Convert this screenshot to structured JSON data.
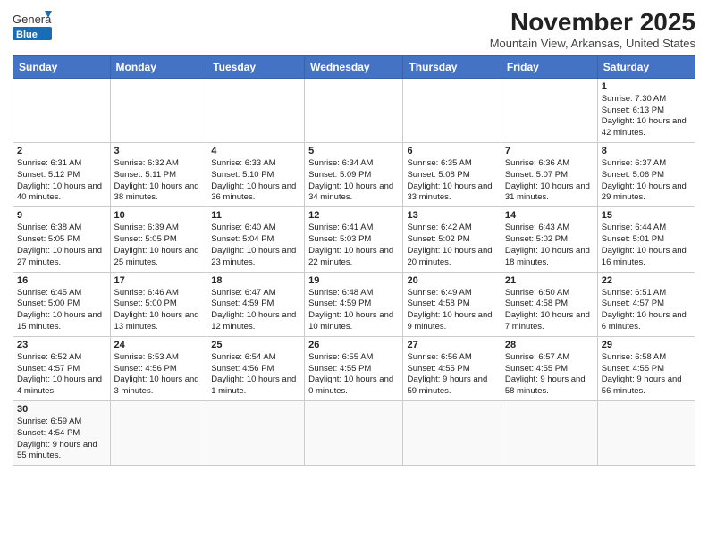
{
  "logo": {
    "text_general": "General",
    "text_blue": "Blue"
  },
  "header": {
    "month": "November 2025",
    "location": "Mountain View, Arkansas, United States"
  },
  "days_of_week": [
    "Sunday",
    "Monday",
    "Tuesday",
    "Wednesday",
    "Thursday",
    "Friday",
    "Saturday"
  ],
  "weeks": [
    [
      {
        "num": "",
        "info": ""
      },
      {
        "num": "",
        "info": ""
      },
      {
        "num": "",
        "info": ""
      },
      {
        "num": "",
        "info": ""
      },
      {
        "num": "",
        "info": ""
      },
      {
        "num": "",
        "info": ""
      },
      {
        "num": "1",
        "info": "Sunrise: 7:30 AM\nSunset: 6:13 PM\nDaylight: 10 hours and 42 minutes."
      }
    ],
    [
      {
        "num": "2",
        "info": "Sunrise: 6:31 AM\nSunset: 5:12 PM\nDaylight: 10 hours and 40 minutes."
      },
      {
        "num": "3",
        "info": "Sunrise: 6:32 AM\nSunset: 5:11 PM\nDaylight: 10 hours and 38 minutes."
      },
      {
        "num": "4",
        "info": "Sunrise: 6:33 AM\nSunset: 5:10 PM\nDaylight: 10 hours and 36 minutes."
      },
      {
        "num": "5",
        "info": "Sunrise: 6:34 AM\nSunset: 5:09 PM\nDaylight: 10 hours and 34 minutes."
      },
      {
        "num": "6",
        "info": "Sunrise: 6:35 AM\nSunset: 5:08 PM\nDaylight: 10 hours and 33 minutes."
      },
      {
        "num": "7",
        "info": "Sunrise: 6:36 AM\nSunset: 5:07 PM\nDaylight: 10 hours and 31 minutes."
      },
      {
        "num": "8",
        "info": "Sunrise: 6:37 AM\nSunset: 5:06 PM\nDaylight: 10 hours and 29 minutes."
      }
    ],
    [
      {
        "num": "9",
        "info": "Sunrise: 6:38 AM\nSunset: 5:05 PM\nDaylight: 10 hours and 27 minutes."
      },
      {
        "num": "10",
        "info": "Sunrise: 6:39 AM\nSunset: 5:05 PM\nDaylight: 10 hours and 25 minutes."
      },
      {
        "num": "11",
        "info": "Sunrise: 6:40 AM\nSunset: 5:04 PM\nDaylight: 10 hours and 23 minutes."
      },
      {
        "num": "12",
        "info": "Sunrise: 6:41 AM\nSunset: 5:03 PM\nDaylight: 10 hours and 22 minutes."
      },
      {
        "num": "13",
        "info": "Sunrise: 6:42 AM\nSunset: 5:02 PM\nDaylight: 10 hours and 20 minutes."
      },
      {
        "num": "14",
        "info": "Sunrise: 6:43 AM\nSunset: 5:02 PM\nDaylight: 10 hours and 18 minutes."
      },
      {
        "num": "15",
        "info": "Sunrise: 6:44 AM\nSunset: 5:01 PM\nDaylight: 10 hours and 16 minutes."
      }
    ],
    [
      {
        "num": "16",
        "info": "Sunrise: 6:45 AM\nSunset: 5:00 PM\nDaylight: 10 hours and 15 minutes."
      },
      {
        "num": "17",
        "info": "Sunrise: 6:46 AM\nSunset: 5:00 PM\nDaylight: 10 hours and 13 minutes."
      },
      {
        "num": "18",
        "info": "Sunrise: 6:47 AM\nSunset: 4:59 PM\nDaylight: 10 hours and 12 minutes."
      },
      {
        "num": "19",
        "info": "Sunrise: 6:48 AM\nSunset: 4:59 PM\nDaylight: 10 hours and 10 minutes."
      },
      {
        "num": "20",
        "info": "Sunrise: 6:49 AM\nSunset: 4:58 PM\nDaylight: 10 hours and 9 minutes."
      },
      {
        "num": "21",
        "info": "Sunrise: 6:50 AM\nSunset: 4:58 PM\nDaylight: 10 hours and 7 minutes."
      },
      {
        "num": "22",
        "info": "Sunrise: 6:51 AM\nSunset: 4:57 PM\nDaylight: 10 hours and 6 minutes."
      }
    ],
    [
      {
        "num": "23",
        "info": "Sunrise: 6:52 AM\nSunset: 4:57 PM\nDaylight: 10 hours and 4 minutes."
      },
      {
        "num": "24",
        "info": "Sunrise: 6:53 AM\nSunset: 4:56 PM\nDaylight: 10 hours and 3 minutes."
      },
      {
        "num": "25",
        "info": "Sunrise: 6:54 AM\nSunset: 4:56 PM\nDaylight: 10 hours and 1 minute."
      },
      {
        "num": "26",
        "info": "Sunrise: 6:55 AM\nSunset: 4:55 PM\nDaylight: 10 hours and 0 minutes."
      },
      {
        "num": "27",
        "info": "Sunrise: 6:56 AM\nSunset: 4:55 PM\nDaylight: 9 hours and 59 minutes."
      },
      {
        "num": "28",
        "info": "Sunrise: 6:57 AM\nSunset: 4:55 PM\nDaylight: 9 hours and 58 minutes."
      },
      {
        "num": "29",
        "info": "Sunrise: 6:58 AM\nSunset: 4:55 PM\nDaylight: 9 hours and 56 minutes."
      }
    ],
    [
      {
        "num": "30",
        "info": "Sunrise: 6:59 AM\nSunset: 4:54 PM\nDaylight: 9 hours and 55 minutes."
      },
      {
        "num": "",
        "info": ""
      },
      {
        "num": "",
        "info": ""
      },
      {
        "num": "",
        "info": ""
      },
      {
        "num": "",
        "info": ""
      },
      {
        "num": "",
        "info": ""
      },
      {
        "num": "",
        "info": ""
      }
    ]
  ]
}
